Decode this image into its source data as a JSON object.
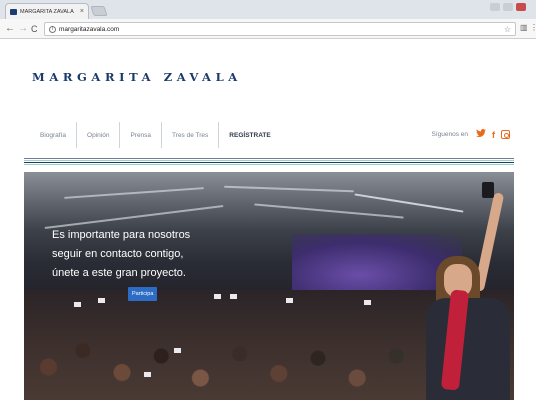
{
  "browser": {
    "tab_title": "MARGARITA ZAVALA",
    "tab_close": "×",
    "url": "margaritazavala.com",
    "back": "←",
    "forward": "→",
    "reload": "C"
  },
  "site": {
    "logo": "MARGARITA ZAVALA",
    "nav": [
      {
        "label": "Biografía"
      },
      {
        "label": "Opinión"
      },
      {
        "label": "Prensa"
      },
      {
        "label": "Tres de Tres"
      },
      {
        "label": "REGÍSTRATE"
      }
    ],
    "social": {
      "label": "Síguenos en",
      "twitter_icon": "twitter-icon",
      "facebook_icon": "facebook-icon",
      "instagram_icon": "instagram-icon"
    },
    "stripe_colors": [
      "#6e7f96",
      "#9ad0c7",
      "#1b3a6b"
    ]
  },
  "hero": {
    "lines": [
      "Es importante para nosotros",
      "seguir en contacto contigo,",
      "únete a este gran proyecto."
    ],
    "button": "Participa"
  },
  "colors": {
    "brand_navy": "#1b3a6b",
    "accent_orange": "#e86a1d",
    "button_blue": "#2c6cc4"
  }
}
